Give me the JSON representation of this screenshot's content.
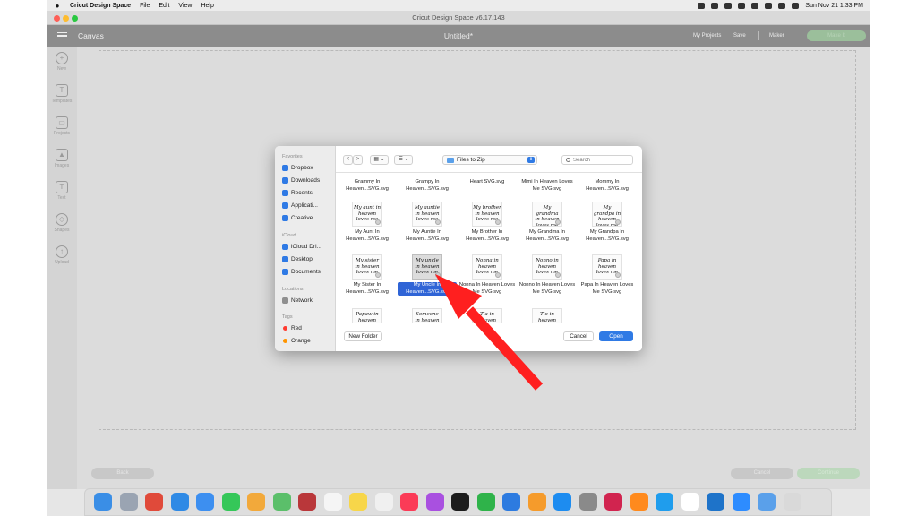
{
  "menubar": {
    "apple": "",
    "app_name": "Cricut Design Space",
    "menus": [
      "File",
      "Edit",
      "View",
      "Help"
    ],
    "datetime": "Sun Nov 21  1:33 PM"
  },
  "window": {
    "title": "Cricut Design Space  v6.17.143"
  },
  "header": {
    "section": "Canvas",
    "document": "Untitled*",
    "my_projects": "My Projects",
    "save": "Save",
    "machine": "Maker",
    "make_it": "Make It"
  },
  "rail": [
    {
      "label": "New",
      "icon": "plus-icon"
    },
    {
      "label": "Templates",
      "icon": "shirt-icon"
    },
    {
      "label": "Projects",
      "icon": "projects-icon"
    },
    {
      "label": "Images",
      "icon": "image-icon"
    },
    {
      "label": "Text",
      "icon": "text-icon"
    },
    {
      "label": "Shapes",
      "icon": "shapes-icon"
    },
    {
      "label": "Upload",
      "icon": "cloud-upload-icon"
    }
  ],
  "bottom": {
    "back": "Back",
    "cancel": "Cancel",
    "continue": "Continue"
  },
  "dialog": {
    "sidebar": {
      "favorites_header": "Favorites",
      "favorites": [
        "Dropbox",
        "Downloads",
        "Recents",
        "Applicati...",
        "Creative..."
      ],
      "icloud_header": "iCloud",
      "icloud": [
        "iCloud Dri...",
        "Desktop",
        "Documents"
      ],
      "locations_header": "Locations",
      "locations": [
        "Network"
      ],
      "tags_header": "Tags",
      "tags": [
        {
          "name": "Red",
          "color": "#ff3b30"
        },
        {
          "name": "Orange",
          "color": "#ff9500"
        }
      ]
    },
    "toolbar": {
      "back": "<",
      "forward": ">",
      "view_mode": "▦ ⌄",
      "group_mode": "☰ ⌄",
      "folder": "Files to Zip",
      "search_placeholder": "Search"
    },
    "files": [
      {
        "name": "Grammy In Heaven...SVG.svg",
        "preview": ""
      },
      {
        "name": "Grampy In Heaven...SVG.svg",
        "preview": ""
      },
      {
        "name": "Heart SVG.svg",
        "preview": ""
      },
      {
        "name": "Mimi In Heaven Loves Me SVG.svg",
        "preview": ""
      },
      {
        "name": "Mommy In Heaven...SVG.svg",
        "preview": ""
      },
      {
        "name": "My Aunt In Heaven...SVG.svg",
        "preview": "My aunt in heaven loves me"
      },
      {
        "name": "My Auntie In Heaven...SVG.svg",
        "preview": "My auntie in heaven loves me"
      },
      {
        "name": "My Brother In Heaven...SVG.svg",
        "preview": "My brother in heaven loves me"
      },
      {
        "name": "My Grandma In Heaven...SVG.svg",
        "preview": "My grandma in heaven loves me"
      },
      {
        "name": "My Grandpa In Heaven...SVG.svg",
        "preview": "My grandpa in heaven loves me"
      },
      {
        "name": "My Sister In Heaven...SVG.svg",
        "preview": "My sister in heaven loves me"
      },
      {
        "name": "My Uncle In Heaven...SVG.svg",
        "preview": "My uncle in heaven loves me",
        "selected": true
      },
      {
        "name": "Nonna In Heaven Loves Me SVG.svg",
        "preview": "Nonna in heaven loves me"
      },
      {
        "name": "Nonno In Heaven Loves Me SVG.svg",
        "preview": "Nonno in heaven loves me"
      },
      {
        "name": "Papa In Heaven Loves Me SVG.svg",
        "preview": "Papa in heaven loves me"
      },
      {
        "name": "",
        "preview": "Papaw in heaven"
      },
      {
        "name": "",
        "preview": "Someone in heaven"
      },
      {
        "name": "",
        "preview": "Tia in heaven"
      },
      {
        "name": "",
        "preview": "Tio in heaven"
      }
    ],
    "new_folder": "New Folder",
    "cancel": "Cancel",
    "open": "Open"
  },
  "annotation": {
    "color": "#ff1f1f"
  },
  "dock": [
    {
      "name": "Finder",
      "color": "#3a8ee6"
    },
    {
      "name": "Launchpad",
      "color": "#9aa4b2"
    },
    {
      "name": "Chrome",
      "color": "#e04a3a"
    },
    {
      "name": "Safari",
      "color": "#2f8ae5"
    },
    {
      "name": "Mail",
      "color": "#3d8ff0"
    },
    {
      "name": "Messages",
      "color": "#35c759"
    },
    {
      "name": "Photos",
      "color": "#f2a93b"
    },
    {
      "name": "Maps",
      "color": "#5bbf6a"
    },
    {
      "name": "Photo Booth",
      "color": "#b9373a"
    },
    {
      "name": "Calendar",
      "color": "#f5f5f5"
    },
    {
      "name": "Notes",
      "color": "#f7d64a"
    },
    {
      "name": "Reminders",
      "color": "#f0f0f0"
    },
    {
      "name": "Music",
      "color": "#fb3b57"
    },
    {
      "name": "Podcasts",
      "color": "#a950e0"
    },
    {
      "name": "TV",
      "color": "#1c1c1c"
    },
    {
      "name": "Numbers",
      "color": "#2fb34a"
    },
    {
      "name": "Keynote",
      "color": "#2d7be0"
    },
    {
      "name": "Pages",
      "color": "#f59b2b"
    },
    {
      "name": "App Store",
      "color": "#1d8cf0"
    },
    {
      "name": "System Preferences",
      "color": "#8a8a8a"
    },
    {
      "name": "InDesign",
      "color": "#d1244f"
    },
    {
      "name": "Illustrator",
      "color": "#ff8a1d"
    },
    {
      "name": "Photoshop",
      "color": "#1f9ded"
    },
    {
      "name": "Cricut",
      "color": "#ffffff"
    },
    {
      "name": "QuickTime",
      "color": "#1e73c9"
    },
    {
      "name": "Zoom",
      "color": "#2d8cff"
    },
    {
      "name": "Downloads",
      "color": "#5aa0ea"
    },
    {
      "name": "Trash",
      "color": "#d9d9d9"
    }
  ]
}
